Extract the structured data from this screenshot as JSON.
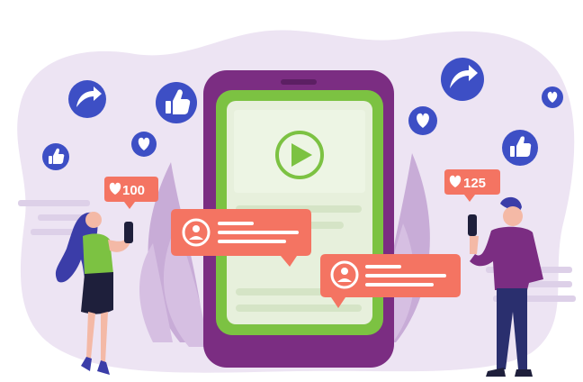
{
  "badges": {
    "left": {
      "icon": "heart-icon",
      "count": "100"
    },
    "right": {
      "icon": "heart-icon",
      "count": "125"
    }
  },
  "floating_icons": [
    "share-arrow-icon",
    "thumbs-up-icon",
    "heart-icon",
    "share-arrow-icon",
    "heart-icon",
    "thumbs-up-icon",
    "heart-icon",
    "thumbs-up-icon"
  ],
  "center_icon": "play-button-icon",
  "comment_icons": [
    "user-avatar-icon",
    "user-avatar-icon"
  ],
  "colors": {
    "background_blob": "#ede4f3",
    "phone_body": "#7b2d82",
    "phone_screen": "#7cc242",
    "screen_panel": "#e7f0dc",
    "accent_coral": "#f47462",
    "icon_blue": "#3d4fc5",
    "leaf_purple": "#c8acd7",
    "woman_hair": "#3b3da8",
    "man_sweater": "#7b2d82"
  }
}
